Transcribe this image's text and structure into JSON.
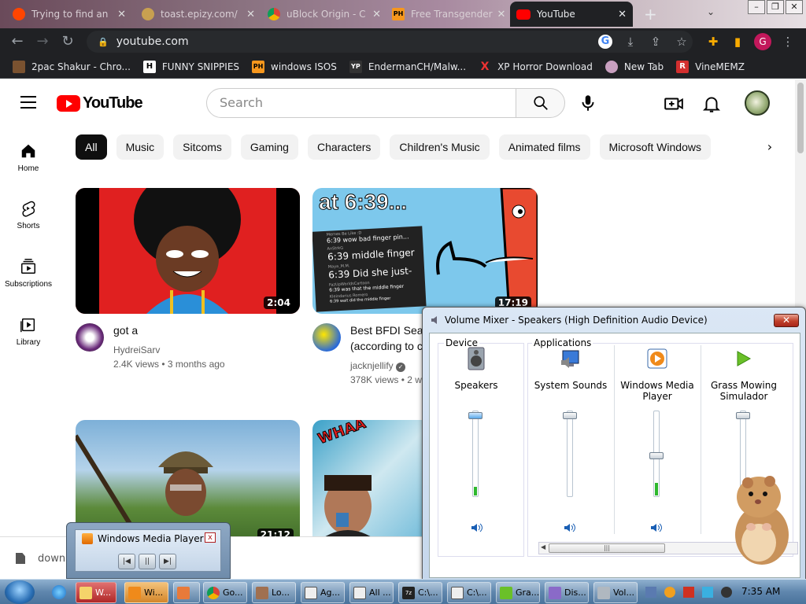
{
  "browser": {
    "tabs": [
      {
        "title": "Trying to find an",
        "icon": "reddit-icon"
      },
      {
        "title": "toast.epizy.com/",
        "icon": "site-icon"
      },
      {
        "title": "uBlock Origin - C",
        "icon": "chrome-icon"
      },
      {
        "title": "Free Transgender",
        "icon": "ph-icon"
      },
      {
        "title": "YouTube",
        "icon": "youtube-icon"
      }
    ],
    "url": "youtube.com",
    "profile_initial": "G",
    "bookmarks": [
      {
        "label": "2pac Shakur - Chro...",
        "icon_text": ""
      },
      {
        "label": "FUNNY SNIPPIES",
        "icon_text": "H"
      },
      {
        "label": "windows ISOS",
        "icon_text": "PH"
      },
      {
        "label": "EndermanCH/Malw...",
        "icon_text": "YP"
      },
      {
        "label": "XP Horror Download",
        "icon_text": "X"
      },
      {
        "label": "New Tab",
        "icon_text": ""
      },
      {
        "label": "VineMEMZ",
        "icon_text": "R"
      }
    ]
  },
  "youtube": {
    "logo_text": "YouTube",
    "search_placeholder": "Search",
    "chips": [
      "All",
      "Music",
      "Sitcoms",
      "Gaming",
      "Characters",
      "Children's Music",
      "Animated films",
      "Microsoft Windows"
    ],
    "sidebar": [
      {
        "label": "Home"
      },
      {
        "label": "Shorts"
      },
      {
        "label": "Subscriptions"
      },
      {
        "label": "Library"
      }
    ],
    "videos": [
      {
        "title": "got a",
        "channel": "HydreiSarv",
        "stats": "2.4K views • 3 months ago",
        "duration": "2:04"
      },
      {
        "title_line1": "Best BFDI Sea",
        "title_line2": "(according to c",
        "channel": "jacknjellify",
        "stats": "378K views • 2 w",
        "duration": "17:19",
        "thumb_text": "at 6:39...",
        "thumb_comments": [
          {
            "user": "Memes Be Like :D",
            "text": "6:39 wow bad finger pin..."
          },
          {
            "user": "AnStrkG",
            "text": "6:39 middle finger"
          },
          {
            "user": "Maya_M.M.",
            "text": "6:39 Did she just-"
          },
          {
            "user": "FazUpWorldsCartoon",
            "text": "6:39 was that the middle finger"
          },
          {
            "user": "Kleindarius Romero",
            "text": "6:39 wait did the middle finger"
          }
        ]
      },
      {
        "duration": "21:12"
      },
      {
        "thumb_text": "WHAA"
      }
    ]
  },
  "volume_mixer": {
    "title": "Volume Mixer - Speakers (High Definition Audio Device)",
    "close": "✕",
    "device_heading": "Device",
    "apps_heading": "Applications",
    "columns": [
      {
        "name": "Speakers",
        "level": 0.95,
        "peak": 0.1
      },
      {
        "name": "System Sounds",
        "level": 0.95,
        "peak": 0
      },
      {
        "name": "Windows Media Player",
        "level": 0.45,
        "peak": 0.15
      },
      {
        "name": "Grass Mowing Simulador",
        "level": 0.95,
        "peak": 0
      }
    ],
    "scroll_grip": "|||"
  },
  "wmp_mini": {
    "title": "Windows Media Player",
    "close": "x",
    "prev": "|◀",
    "pause": "||",
    "next": "▶|"
  },
  "download_bar": {
    "text": "downl"
  },
  "taskbar": {
    "tasks": [
      "W...",
      "Wi...",
      "",
      "Go...",
      "Lo...",
      "Ag...",
      "All ...",
      "C:\\...",
      "C:\\...",
      "Gra...",
      "Dis...",
      "Vol..."
    ],
    "clock": "7:35 AM"
  }
}
